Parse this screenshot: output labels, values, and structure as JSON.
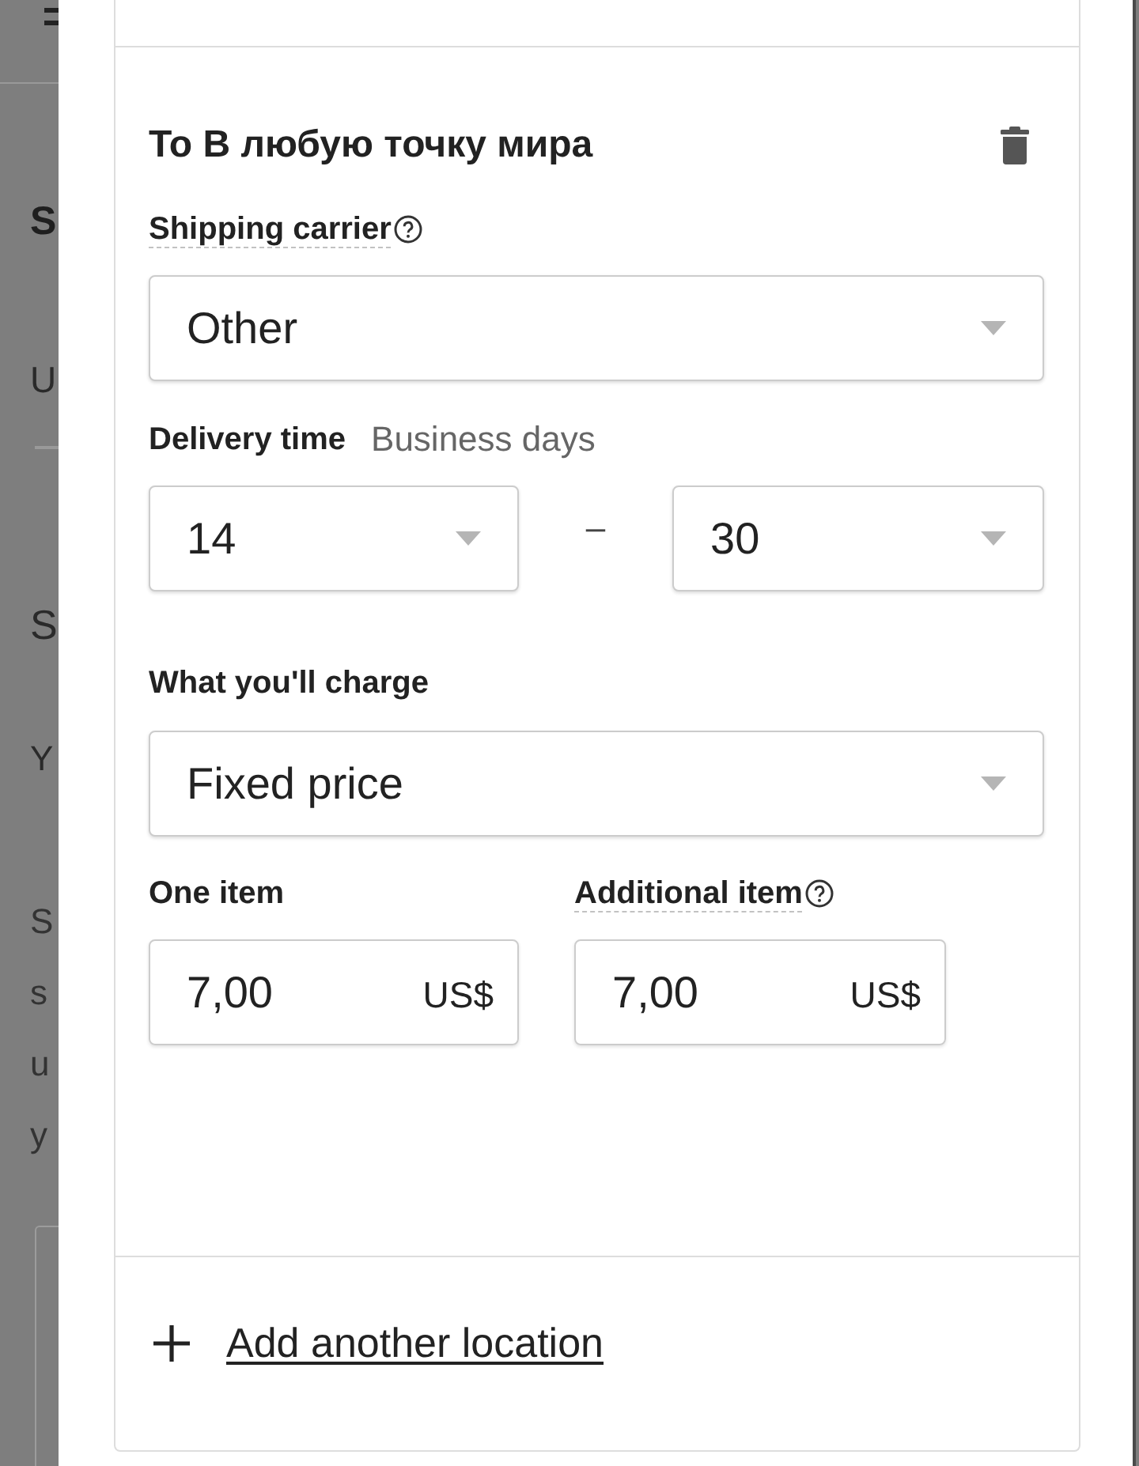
{
  "background_page": {
    "texts": [
      {
        "kind": "heading",
        "text": "S"
      },
      {
        "kind": "tab",
        "text": "U"
      },
      {
        "kind": "title",
        "text": "S"
      },
      {
        "kind": "subtitle",
        "text": "Y"
      },
      {
        "kind": "body",
        "text": "S"
      },
      {
        "kind": "body",
        "text": "s"
      },
      {
        "kind": "body",
        "text": "u"
      },
      {
        "kind": "body",
        "text": "y"
      }
    ]
  },
  "location": {
    "title": "To В любую точку мира",
    "shipping_carrier": {
      "label": "Shipping carrier",
      "help": true,
      "value": "Other"
    },
    "delivery_time": {
      "label": "Delivery time",
      "hint": "Business days",
      "min": "14",
      "separator": "–",
      "max": "30"
    },
    "charge": {
      "label": "What you'll charge",
      "value": "Fixed price"
    },
    "prices": [
      {
        "label": "One item",
        "help": false,
        "value": "7,00",
        "currency": "US$"
      },
      {
        "label": "Additional item",
        "help": true,
        "value": "7,00",
        "currency": "US$"
      }
    ]
  },
  "add_location": "Add another location"
}
